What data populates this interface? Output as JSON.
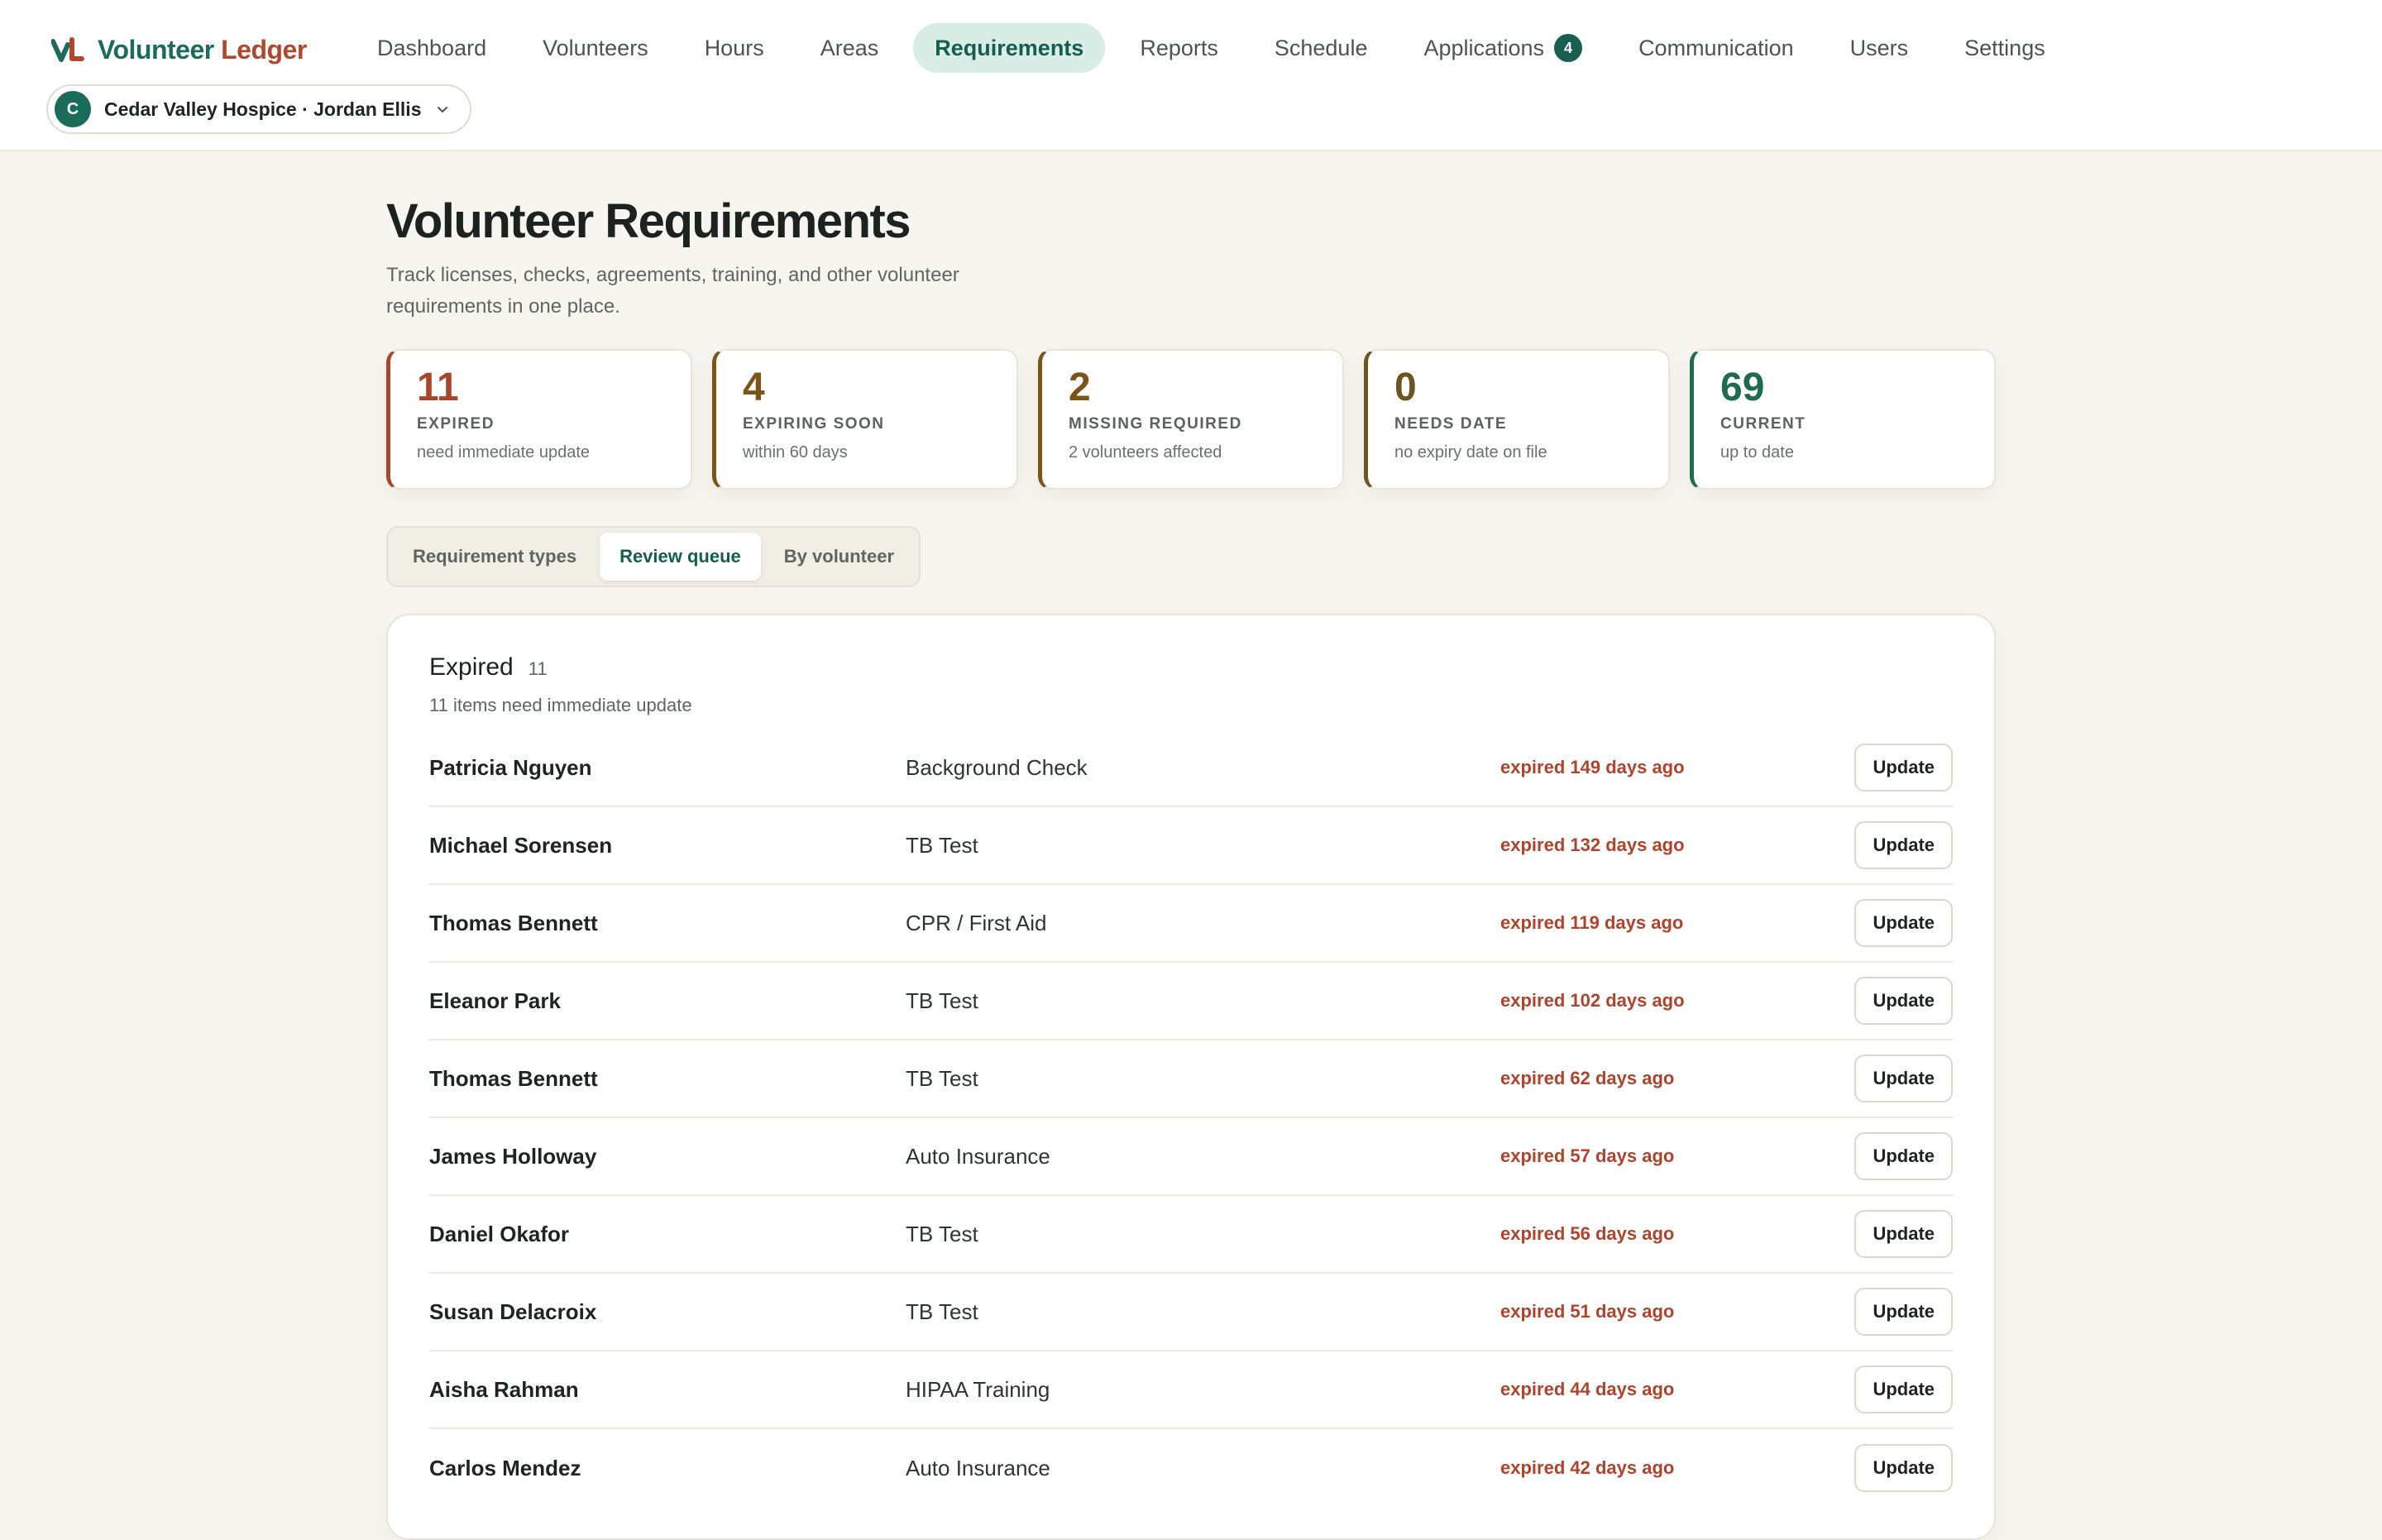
{
  "app": {
    "brand_part1": "Volunteer",
    "brand_part2": "Ledger",
    "colors": {
      "accent": "#1c6b5c",
      "brand_red": "#b0482e",
      "background": "#f7f5ef"
    }
  },
  "nav": {
    "items": [
      {
        "label": "Dashboard"
      },
      {
        "label": "Volunteers"
      },
      {
        "label": "Hours"
      },
      {
        "label": "Areas"
      },
      {
        "label": "Requirements",
        "active": true
      },
      {
        "label": "Reports"
      },
      {
        "label": "Schedule"
      },
      {
        "label": "Applications",
        "badge": "4"
      },
      {
        "label": "Communication"
      },
      {
        "label": "Users"
      },
      {
        "label": "Settings"
      }
    ]
  },
  "org": {
    "avatar_letter": "C",
    "label": "Cedar Valley Hospice · Jordan Ellis"
  },
  "page": {
    "title": "Volunteer Requirements",
    "subtitle": "Track licenses, checks, agreements, training, and other volunteer requirements in one place."
  },
  "stats": [
    {
      "value": "11",
      "label": "EXPIRED",
      "desc": "need immediate update",
      "color": "#a8452b"
    },
    {
      "value": "4",
      "label": "EXPIRING SOON",
      "desc": "within 60 days",
      "color": "#7a5418"
    },
    {
      "value": "2",
      "label": "MISSING REQUIRED",
      "desc": "2 volunteers affected",
      "color": "#7a5418"
    },
    {
      "value": "0",
      "label": "NEEDS DATE",
      "desc": "no expiry date on file",
      "color": "#6b5520"
    },
    {
      "value": "69",
      "label": "CURRENT",
      "desc": "up to date",
      "color": "#1f6b50"
    }
  ],
  "tabs": [
    {
      "label": "Requirement types"
    },
    {
      "label": "Review queue",
      "active": true
    },
    {
      "label": "By volunteer"
    }
  ],
  "panel": {
    "title": "Expired",
    "count": "11",
    "subtitle": "11 items need immediate update",
    "update_label": "Update",
    "rows": [
      {
        "name": "Patricia Nguyen",
        "requirement": "Background Check",
        "status": "expired 149 days ago"
      },
      {
        "name": "Michael Sorensen",
        "requirement": "TB Test",
        "status": "expired 132 days ago"
      },
      {
        "name": "Thomas Bennett",
        "requirement": "CPR / First Aid",
        "status": "expired 119 days ago"
      },
      {
        "name": "Eleanor Park",
        "requirement": "TB Test",
        "status": "expired 102 days ago"
      },
      {
        "name": "Thomas Bennett",
        "requirement": "TB Test",
        "status": "expired 62 days ago"
      },
      {
        "name": "James Holloway",
        "requirement": "Auto Insurance",
        "status": "expired 57 days ago"
      },
      {
        "name": "Daniel Okafor",
        "requirement": "TB Test",
        "status": "expired 56 days ago"
      },
      {
        "name": "Susan Delacroix",
        "requirement": "TB Test",
        "status": "expired 51 days ago"
      },
      {
        "name": "Aisha Rahman",
        "requirement": "HIPAA Training",
        "status": "expired 44 days ago"
      },
      {
        "name": "Carlos Mendez",
        "requirement": "Auto Insurance",
        "status": "expired 42 days ago"
      }
    ]
  }
}
